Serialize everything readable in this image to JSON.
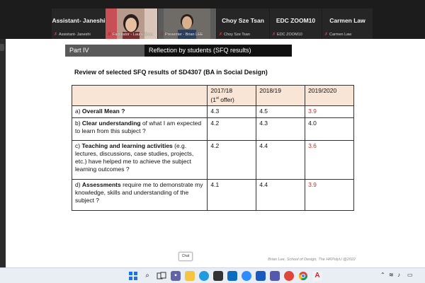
{
  "participants": [
    {
      "display": "Assistant- Janeshi",
      "label": "Assistant- Janeshi",
      "muted": true,
      "video": false
    },
    {
      "display": "",
      "label": "Facilitator - Laura Zhou",
      "muted": true,
      "video": true
    },
    {
      "display": "",
      "label": "Presenter - Brian LEE",
      "muted": true,
      "video": true
    },
    {
      "display": "Choy Sze Tsan",
      "label": "Choy Sze Tsan",
      "muted": true,
      "video": false
    },
    {
      "display": "EDC ZOOM10",
      "label": "EDC ZOOM10",
      "muted": true,
      "video": false
    },
    {
      "display": "Carmen Law",
      "label": "Carmen Law",
      "muted": true,
      "video": false
    }
  ],
  "slide": {
    "section_tag": "Part IV",
    "section_title": "Reflection by students (SFQ results)",
    "review_title": "Review of selected SFQ results of SD4307 (BA in Social Design)",
    "footer": "Brian Lee, School of Design, The HKPolyU @2022",
    "table": {
      "headers": [
        "",
        "2017/18",
        "2018/19",
        "2019/2020"
      ],
      "header_note_prefix": "(1",
      "header_note_sup": "st",
      "header_note_suffix": " offer)",
      "rows": [
        {
          "prefix": "a) ",
          "bold": "Overall Mean ?",
          "rest": "",
          "v1": "4.3",
          "v2": "4.5",
          "v3": "3.9",
          "v3_red": true
        },
        {
          "prefix": "b) ",
          "bold": "Clear understanding",
          "rest": " of what I am expected to learn from this subject ?",
          "v1": "4.2",
          "v2": "4.3",
          "v3": "4.0",
          "v3_red": false
        },
        {
          "prefix": "c) ",
          "bold": "Teaching and learning activities",
          "rest": " (e.g. lectures, discussions, case studies, projects, etc.) have helped me to achieve the subject learning outcomes ?",
          "v1": "4.2",
          "v2": "4.4",
          "v3": "3.6",
          "v3_red": true
        },
        {
          "prefix": "d) ",
          "bold": "Assessments",
          "rest": " require me to demonstrate my knowledge, skills and understanding of the subject ?",
          "v1": "4.1",
          "v2": "4.4",
          "v3": "3.9",
          "v3_red": true
        }
      ]
    }
  },
  "chat_label": "Chat",
  "colors": {
    "header_fill": "#f8e5d6",
    "highlight_red": "#c8322b",
    "section_tag_bg": "#5a5a5a",
    "section_title_bg": "#111111",
    "muted_mic": "#e0453a"
  },
  "taskbar": {
    "icons": [
      "windows-start-icon",
      "search-icon",
      "task-view-icon",
      "chat-icon",
      "file-explorer-icon",
      "edge-icon",
      "store-icon",
      "mail-icon",
      "zoom-icon",
      "word-icon",
      "teams-icon",
      "media-icon",
      "chrome-icon",
      "acrobat-icon"
    ],
    "tray_icons": [
      "chevron-up-icon",
      "wifi-icon",
      "speaker-icon",
      "battery-icon"
    ]
  }
}
